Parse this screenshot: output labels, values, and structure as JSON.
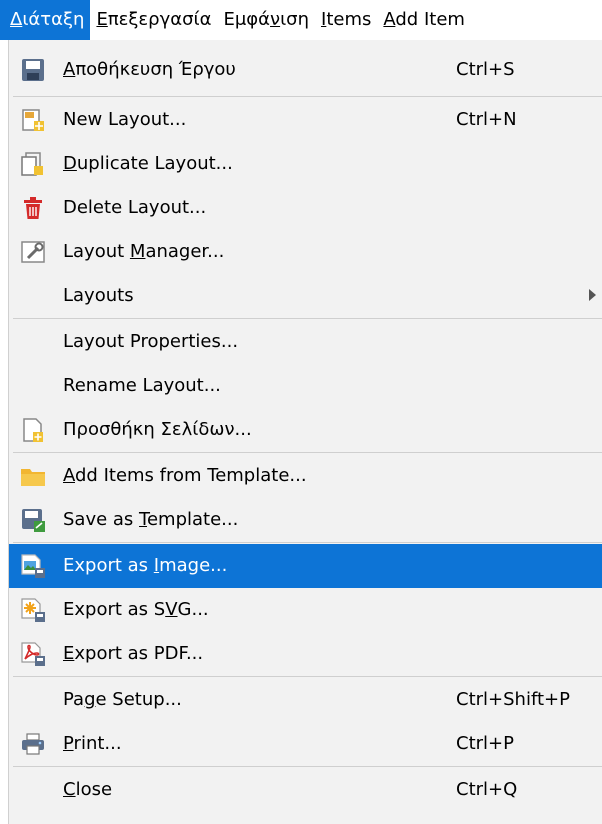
{
  "menubar": {
    "items": [
      {
        "pre": "",
        "u": "Δ",
        "post": "ιάταξη",
        "active": true
      },
      {
        "pre": "",
        "u": "Ε",
        "post": "πεξεργασία",
        "active": false
      },
      {
        "pre": "Εμφά",
        "u": "ν",
        "post": "ιση",
        "active": false
      },
      {
        "pre": "",
        "u": "I",
        "post": "tems",
        "active": false
      },
      {
        "pre": "",
        "u": "A",
        "post": "dd Item",
        "active": false
      }
    ]
  },
  "menu": {
    "items": [
      {
        "pre": "",
        "u": "Α",
        "post": "ποθήκευση Έργου",
        "shortcut": "Ctrl+S",
        "icon": "save-project-icon"
      },
      {
        "pre": "New Layout...",
        "u": "",
        "post": "",
        "shortcut": "Ctrl+N",
        "icon": "new-layout-icon"
      },
      {
        "pre": "",
        "u": "D",
        "post": "uplicate Layout...",
        "shortcut": "",
        "icon": "duplicate-layout-icon"
      },
      {
        "pre": "Delete Layout...",
        "u": "",
        "post": "",
        "shortcut": "",
        "icon": "trash-icon"
      },
      {
        "pre": "Layout ",
        "u": "M",
        "post": "anager...",
        "shortcut": "",
        "icon": "layout-manager-icon"
      },
      {
        "pre": "Layouts",
        "u": "",
        "post": "",
        "shortcut": "",
        "icon": "",
        "submenu": true
      },
      {
        "pre": "Layout Properties...",
        "u": "",
        "post": "",
        "shortcut": "",
        "icon": ""
      },
      {
        "pre": "Rename Layout...",
        "u": "",
        "post": "",
        "shortcut": "",
        "icon": ""
      },
      {
        "pre": "Προσθήκη Σελίδων...",
        "u": "",
        "post": "",
        "shortcut": "",
        "icon": "add-pages-icon"
      },
      {
        "pre": "",
        "u": "A",
        "post": "dd Items from Template...",
        "shortcut": "",
        "icon": "folder-icon"
      },
      {
        "pre": "Save as ",
        "u": "T",
        "post": "emplate...",
        "shortcut": "",
        "icon": "save-template-icon"
      },
      {
        "pre": "Export as ",
        "u": "I",
        "post": "mage...",
        "shortcut": "",
        "icon": "export-image-icon",
        "selected": true
      },
      {
        "pre": "Export as S",
        "u": "V",
        "post": "G...",
        "shortcut": "",
        "icon": "export-svg-icon"
      },
      {
        "pre": "",
        "u": "E",
        "post": "xport as PDF...",
        "shortcut": "",
        "icon": "export-pdf-icon"
      },
      {
        "pre": "Pa",
        "u": "g",
        "post": "e Setup...",
        "shortcut": "Ctrl+Shift+P",
        "icon": ""
      },
      {
        "pre": "",
        "u": "P",
        "post": "rint...",
        "shortcut": "Ctrl+P",
        "icon": "printer-icon"
      },
      {
        "pre": "",
        "u": "C",
        "post": "lose",
        "shortcut": "Ctrl+Q",
        "icon": ""
      }
    ]
  },
  "colors": {
    "highlight": "#0d74d6",
    "menu_bg": "#f2f2f2"
  }
}
